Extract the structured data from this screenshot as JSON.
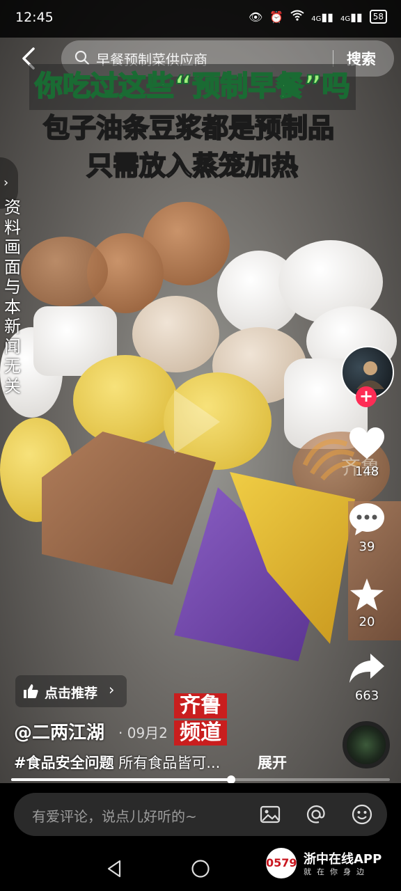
{
  "status_bar": {
    "time": "12:45",
    "battery": "58",
    "network_label": "4G"
  },
  "search": {
    "query": "早餐预制菜供应商",
    "button_label": "搜索"
  },
  "video": {
    "caption_line1_prefix": "你吃过这些",
    "caption_line1_highlight": "“预制早餐”",
    "caption_line1_suffix": "吗",
    "caption_line2": "包子油条豆浆都是预制品",
    "caption_line3": "只需放入蒸笼加热",
    "disclaimer": "资料画面与本新闻无关",
    "watermark": "齐鲁",
    "station_logo_line1": "齐鲁",
    "station_logo_line2": "频道"
  },
  "actions": {
    "follow_symbol": "+",
    "likes": "148",
    "comments": "39",
    "favorites": "20",
    "shares": "663"
  },
  "recommend": {
    "label": "点击推荐",
    "chevron": "›"
  },
  "post": {
    "author": "@二两江湖",
    "date": "· 09月2",
    "hashtag": "#食品安全问题",
    "description": " 所有食品皆可...",
    "expand_label": "展开"
  },
  "progress": {
    "played_fraction": 0.58
  },
  "comment_bar": {
    "placeholder": "有爱评论，说点儿好听的~"
  },
  "brand": {
    "logo_text": "0579",
    "name": "浙中在线APP",
    "slogan": "就在你身边"
  },
  "colors": {
    "accent_red": "#fe2c55",
    "station_red": "#c91e1e",
    "caption_yellow": "#ffe01a",
    "caption_green": "#9df07a"
  }
}
